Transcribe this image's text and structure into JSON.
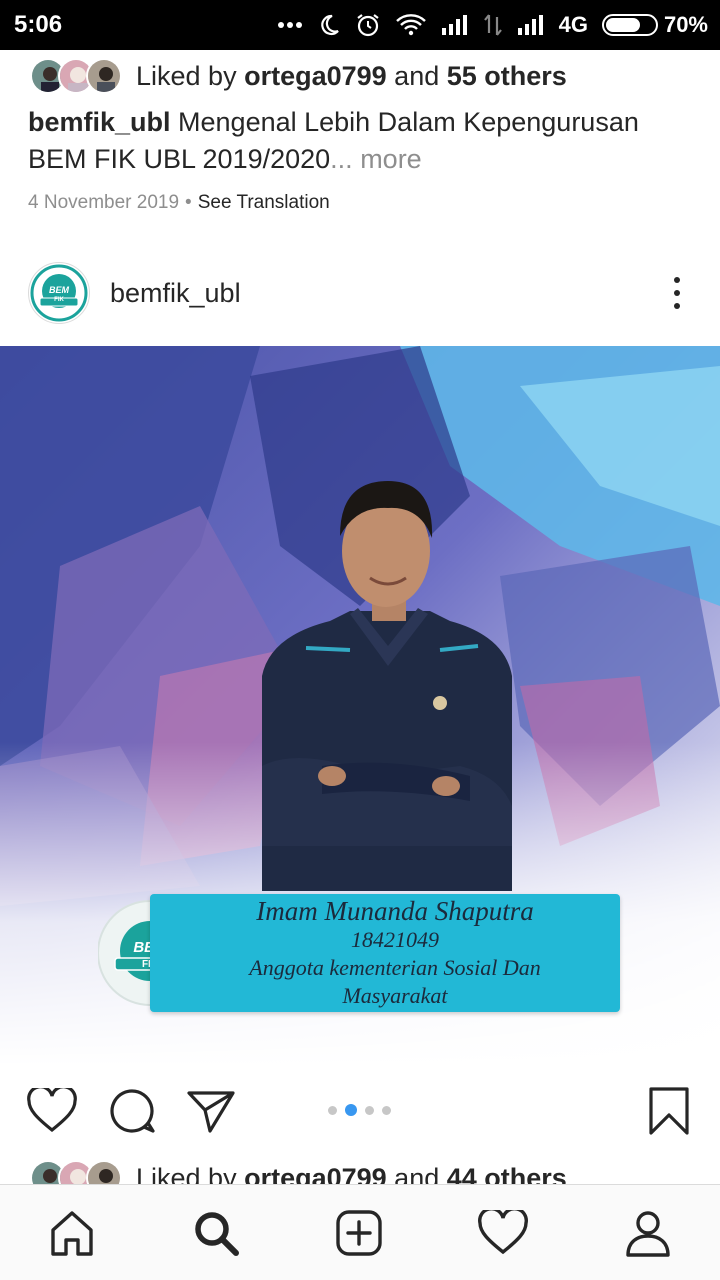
{
  "status_bar": {
    "time": "5:06",
    "network": "4G",
    "battery": "70%",
    "battery_level": 0.7
  },
  "previous_post": {
    "likes": {
      "prefix": "Liked by ",
      "user": "ortega0799",
      "middle": " and ",
      "others": "55 others"
    },
    "caption": {
      "username": "bemfik_ubl",
      "text": " Mengenal Lebih Dalam Kepengurusan BEM FIK UBL 2019/2020",
      "ellipsis": "... ",
      "more": "more"
    },
    "date": "4 November 2019",
    "separator": "•",
    "see_translation": "See Translation"
  },
  "post": {
    "username": "bemfik_ubl",
    "logo_text": "BEM FIK",
    "image": {
      "name": "Imam Munanda Shaputra",
      "id": "18421049",
      "role_line1": "Anggota kementerian Sosial Dan",
      "role_line2": "Masyarakat"
    },
    "carousel_index": 1,
    "carousel_count": 4,
    "likes": {
      "prefix": "Liked by ",
      "user": "ortega0799",
      "middle": " and ",
      "others": "44 others"
    }
  },
  "colors": {
    "accent_blue": "#3897f0",
    "card_cyan": "#22b8d6",
    "logo_teal": "#1ba39c"
  },
  "icons": {
    "like": "heart-icon",
    "comment": "comment-icon",
    "share": "paper-plane-icon",
    "save": "bookmark-icon",
    "more": "kebab-icon",
    "nav": [
      "home-icon",
      "search-icon",
      "add-icon",
      "activity-heart-icon",
      "profile-icon"
    ]
  }
}
